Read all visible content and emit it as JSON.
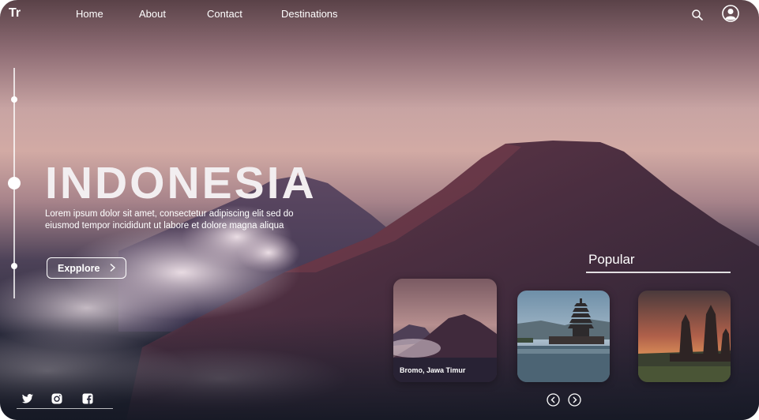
{
  "nav": {
    "logo": "Tr",
    "links": [
      "Home",
      "About",
      "Contact",
      "Destinations"
    ]
  },
  "icons": {
    "search": "search-icon",
    "user": "user-icon",
    "explore_chevron": "chevron-right-icon",
    "prev": "chevron-left-circle-icon",
    "next": "chevron-right-circle-icon",
    "social": [
      "twitter-icon",
      "instagram-icon",
      "facebook-icon"
    ]
  },
  "hero": {
    "title": "INDONESIA",
    "description": "Lorem ipsum dolor sit amet, consectetur adipiscing elit sed do eiusmod tempor incididunt ut labore et dolore magna aliqua",
    "button_label": "Expplore"
  },
  "popular": {
    "heading": "Popular",
    "cards": [
      {
        "caption": "Bromo, Jawa Timur"
      }
    ]
  },
  "slides": {
    "total": 3,
    "active": 2
  },
  "colors": {
    "sky_top": "#5a4248",
    "sky_glow": "#d2aaa4",
    "mountain": "#4a2e40",
    "bottom": "#1c1f2b",
    "text": "#ffffff"
  }
}
